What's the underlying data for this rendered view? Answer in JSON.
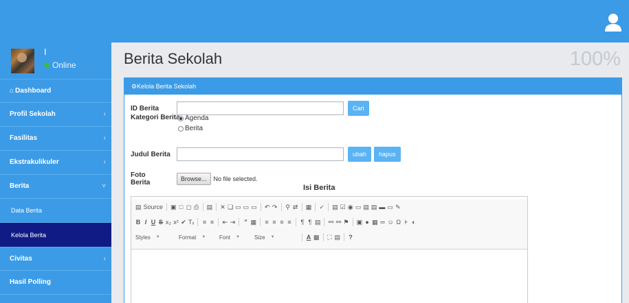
{
  "topbar": {
    "user_icon": "user-icon",
    "color": "#3c9be6"
  },
  "sidebar": {
    "user_name": "I",
    "user_status": "Online",
    "status_color": "#3cb94f",
    "active_color": "#101b85",
    "items": [
      {
        "label": "Dashboard",
        "icon": "dashboard-icon",
        "glyph": "⌂"
      },
      {
        "label": "Profil Sekolah",
        "chevron": "‹"
      },
      {
        "label": "Fasilitas",
        "chevron": "‹"
      },
      {
        "label": "Ekstrakulikuler",
        "chevron": "‹"
      },
      {
        "label": "Berita",
        "chevron": "˅"
      },
      {
        "label": "Data Berita"
      },
      {
        "label": "Kelola Berita"
      },
      {
        "label": "Civitas",
        "chevron": "‹"
      },
      {
        "label": "Hasil Polling"
      }
    ]
  },
  "main": {
    "title": "Berita Sekolah",
    "zoom": "100%",
    "panel_title": "Kelola Berita Sekolah",
    "panel_icon": "⚙"
  },
  "form": {
    "id_label": "ID Berita",
    "id_value": "",
    "cari_label": "Cari",
    "kategori_label": "Kategori Berita",
    "kategori_options": [
      "Agenda",
      "Berita"
    ],
    "kategori_selected": "Agenda",
    "judul_label": "Judul Berita",
    "judul_value": "",
    "ubah_label": "ubah",
    "hapus_label": "hapus",
    "foto_label": "Foto Berita",
    "browse_label": "Browse...",
    "file_status": "No file selected.",
    "isi_label": "Isi Berita"
  },
  "editor": {
    "source_label": "Source",
    "styles_label": "Styles",
    "format_label": "Format",
    "font_label": "Font",
    "size_label": "Size",
    "help_label": "?"
  }
}
